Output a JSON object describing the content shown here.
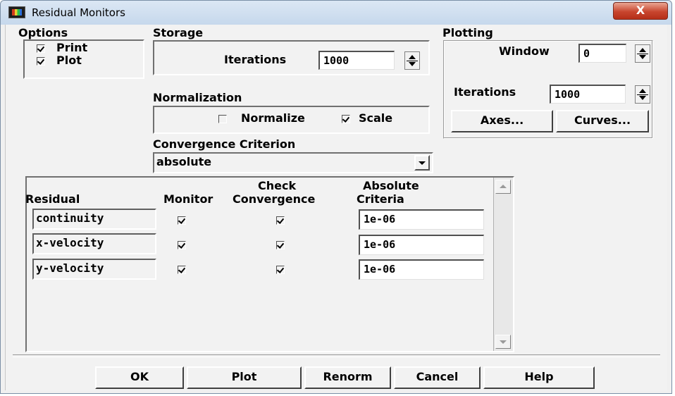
{
  "window": {
    "title": "Residual Monitors",
    "close_label": "X"
  },
  "options": {
    "label": "Options",
    "print": {
      "label": "Print",
      "checked": true
    },
    "plot": {
      "label": "Plot",
      "checked": true
    }
  },
  "storage": {
    "label": "Storage",
    "iterations_label": "Iterations",
    "iterations_value": "1000"
  },
  "normalization": {
    "label": "Normalization",
    "normalize": {
      "label": "Normalize",
      "checked": false
    },
    "scale": {
      "label": "Scale",
      "checked": true
    }
  },
  "convergence": {
    "label": "Convergence Criterion",
    "selected": "absolute"
  },
  "plotting": {
    "label": "Plotting",
    "window_label": "Window",
    "window_value": "0",
    "iterations_label": "Iterations",
    "iterations_value": "1000",
    "axes_button": "Axes...",
    "curves_button": "Curves..."
  },
  "table": {
    "headers": {
      "residual": "Residual",
      "monitor": "Monitor",
      "check_line1": "Check",
      "check_line2": "Convergence",
      "absolute_line1": "Absolute",
      "absolute_line2": "Criteria"
    },
    "rows": [
      {
        "name": "continuity",
        "monitor": true,
        "check": true,
        "criteria": "1e-06"
      },
      {
        "name": "x-velocity",
        "monitor": true,
        "check": true,
        "criteria": "1e-06"
      },
      {
        "name": "y-velocity",
        "monitor": true,
        "check": true,
        "criteria": "1e-06"
      }
    ]
  },
  "buttons": {
    "ok": "OK",
    "plot": "Plot",
    "renorm": "Renorm",
    "cancel": "Cancel",
    "help": "Help"
  },
  "colors": {
    "title_bar": "#c6d8ec",
    "close_button": "#c8452e",
    "dialog_bg": "#f2f2f2"
  }
}
